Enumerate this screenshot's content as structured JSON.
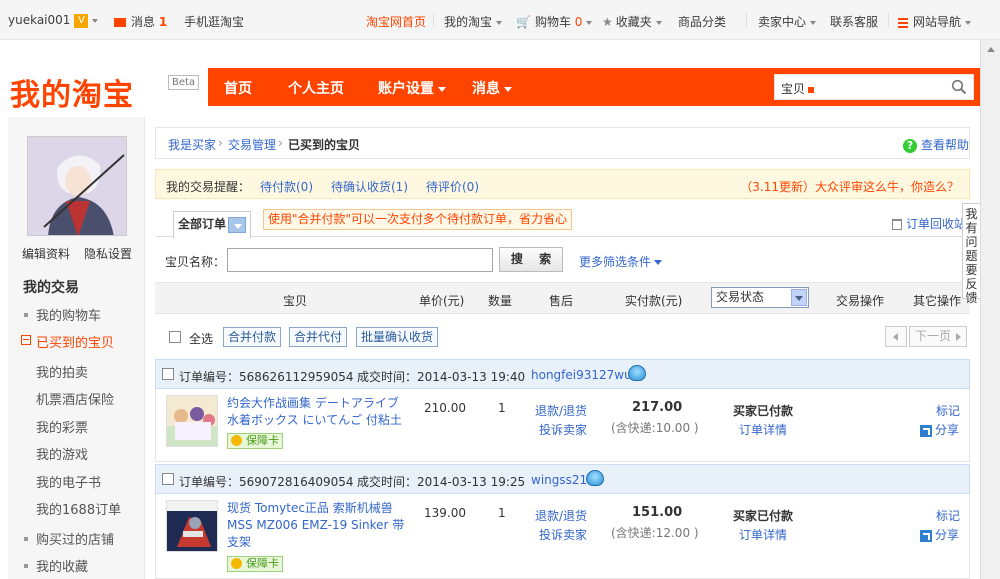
{
  "topbar": {
    "username": "yuekai001",
    "vip_badge": "V",
    "messages_label": "消息",
    "messages_count": "1",
    "mobile_label": "手机逛淘宝",
    "home_label": "淘宝网首页",
    "my_taobao_label": "我的淘宝",
    "cart_label": "购物车",
    "cart_count": "0",
    "favorites_label": "收藏夹",
    "categories_label": "商品分类",
    "seller_center_label": "卖家中心",
    "contact_label": "联系客服",
    "site_nav_label": "网站导航"
  },
  "header": {
    "logo_text": "我的淘宝",
    "beta_label": "Beta",
    "nav": [
      "首页",
      "个人主页",
      "账户设置",
      "消息"
    ],
    "search_category": "宝贝",
    "search_placeholder": ""
  },
  "sidebar": {
    "edit_profile": "编辑资料",
    "privacy": "隐私设置",
    "section_title": "我的交易",
    "items": [
      "我的购物车",
      "已买到的宝贝",
      "我的拍卖",
      "机票酒店保险",
      "我的彩票",
      "我的游戏",
      "我的电子书",
      "我的1688订单",
      "购买过的店铺",
      "我的收藏"
    ]
  },
  "breadcrumb": {
    "items": [
      "我是买家",
      "交易管理",
      "已买到的宝贝"
    ],
    "separator": "›",
    "help_label": "查看帮助"
  },
  "reminder": {
    "label": "我的交易提醒：",
    "pending_pay": "待付款(0)",
    "pending_confirm": "待确认收货(1)",
    "pending_review": "待评价(0)",
    "promo": "（3.11更新）大众评审这么牛，你造么？"
  },
  "tabs": {
    "all_orders": "全部订单",
    "tip": "使用\"合并付款\"可以一次支付多个待付款订单，省力省心",
    "recycle_label": "订单回收站"
  },
  "search_row": {
    "label": "宝贝名称：",
    "input_value": "",
    "button_label": "搜 索",
    "more_filters": "更多筛选条件"
  },
  "table_header": {
    "columns": [
      "宝贝",
      "单价(元)",
      "数量",
      "售后",
      "实付款(元)",
      "交易状态",
      "交易操作",
      "其它操作"
    ],
    "status_selected": "交易状态"
  },
  "batch": {
    "select_all": "全选",
    "merge_pay": "合并付款",
    "merge_proxy": "合并代付",
    "batch_confirm": "批量确认收货",
    "next_page": "下一页"
  },
  "feedback": {
    "label": "我有问题要反馈"
  },
  "orders": [
    {
      "order_label": "订单编号：",
      "order_no": "568626112959054",
      "time_label": "成交时间：",
      "time": "2014-03-13 19:40",
      "seller": "hongfei93127wu",
      "title": "约会大作战画集 デートアライブ 水着ボックス にいてんご 付粘土",
      "guard": "保障卡",
      "price": "210.00",
      "qty": "1",
      "refund_label": "退款/退货",
      "complain_label": "投诉卖家",
      "paid": "217.00",
      "shipping": "(含快递:10.00 )",
      "status": "买家已付款",
      "detail_label": "订单详情",
      "mark_label": "标记",
      "share_label": "分享"
    },
    {
      "order_label": "订单编号：",
      "order_no": "569072816409054",
      "time_label": "成交时间：",
      "time": "2014-03-13 19:25",
      "seller": "wingss21",
      "title": "现货 Tomytec正品 索斯机械兽 MSS MZ006 EMZ-19 Sinker 带支架",
      "guard": "保障卡",
      "price": "139.00",
      "qty": "1",
      "refund_label": "退款/退货",
      "complain_label": "投诉卖家",
      "paid": "151.00",
      "shipping": "(含快递:12.00 )",
      "status": "买家已付款",
      "detail_label": "订单详情",
      "mark_label": "标记",
      "share_label": "分享"
    }
  ],
  "colors": {
    "brand": "#ff4400",
    "link": "#3366cc",
    "order_header_bg": "#e8f0fa"
  }
}
